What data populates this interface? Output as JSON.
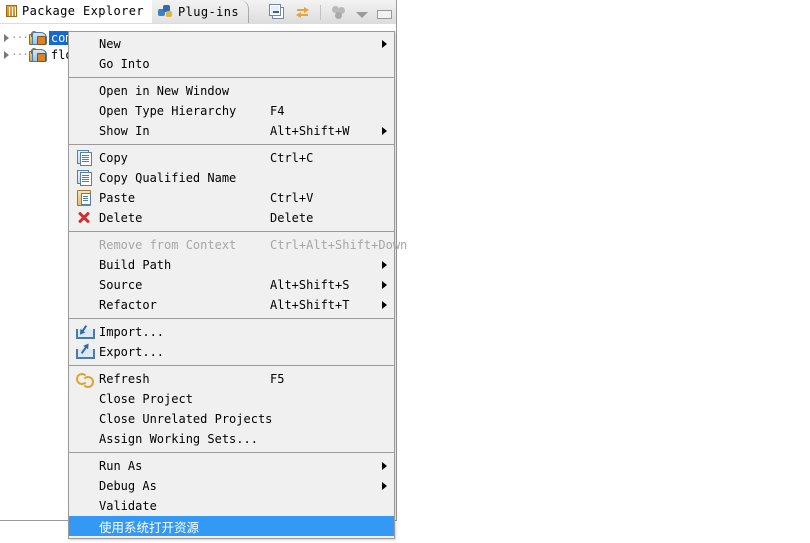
{
  "view": {
    "tabs": [
      {
        "label": "Package Explorer",
        "icon": "package-explorer-icon",
        "active": true,
        "close": "✖"
      },
      {
        "label": "Plug-ins",
        "icon": "plugins-icon",
        "active": false
      }
    ],
    "toolbar": [
      {
        "name": "collapse-all-icon"
      },
      {
        "name": "link-with-editor-icon"
      },
      {
        "name": "view-menu-icon"
      },
      {
        "name": "view-dropdown-icon"
      },
      {
        "name": "minimize-icon"
      }
    ],
    "tree": [
      {
        "label": "com.l",
        "selected": true,
        "icon": "package-fragment-icon"
      },
      {
        "label": "flow",
        "selected": false,
        "icon": "package-fragment-icon"
      }
    ]
  },
  "context_menu": {
    "items": [
      {
        "label": "New",
        "shortcut": "",
        "icon": "",
        "submenu": true,
        "disabled": false,
        "highlighted": false
      },
      {
        "label": "Go Into",
        "shortcut": "",
        "icon": "",
        "submenu": false,
        "disabled": false,
        "highlighted": false
      },
      {
        "separator": true
      },
      {
        "label": "Open in New Window",
        "shortcut": "",
        "icon": "",
        "submenu": false,
        "disabled": false,
        "highlighted": false
      },
      {
        "label": "Open Type Hierarchy",
        "shortcut": "F4",
        "icon": "",
        "submenu": false,
        "disabled": false,
        "highlighted": false
      },
      {
        "label": "Show In",
        "shortcut": "Alt+Shift+W",
        "icon": "",
        "submenu": true,
        "disabled": false,
        "highlighted": false
      },
      {
        "separator": true
      },
      {
        "label": "Copy",
        "shortcut": "Ctrl+C",
        "icon": "copy-icon",
        "submenu": false,
        "disabled": false,
        "highlighted": false
      },
      {
        "label": "Copy Qualified Name",
        "shortcut": "",
        "icon": "copy-icon",
        "submenu": false,
        "disabled": false,
        "highlighted": false
      },
      {
        "label": "Paste",
        "shortcut": "Ctrl+V",
        "icon": "paste-icon",
        "submenu": false,
        "disabled": false,
        "highlighted": false
      },
      {
        "label": "Delete",
        "shortcut": "Delete",
        "icon": "delete-icon",
        "submenu": false,
        "disabled": false,
        "highlighted": false
      },
      {
        "separator": true
      },
      {
        "label": "Remove from Context",
        "shortcut": "Ctrl+Alt+Shift+Down",
        "icon": "",
        "submenu": false,
        "disabled": true,
        "highlighted": false
      },
      {
        "label": "Build Path",
        "shortcut": "",
        "icon": "",
        "submenu": true,
        "disabled": false,
        "highlighted": false
      },
      {
        "label": "Source",
        "shortcut": "Alt+Shift+S",
        "icon": "",
        "submenu": true,
        "disabled": false,
        "highlighted": false
      },
      {
        "label": "Refactor",
        "shortcut": "Alt+Shift+T",
        "icon": "",
        "submenu": true,
        "disabled": false,
        "highlighted": false
      },
      {
        "separator": true
      },
      {
        "label": "Import...",
        "shortcut": "",
        "icon": "import-icon",
        "submenu": false,
        "disabled": false,
        "highlighted": false
      },
      {
        "label": "Export...",
        "shortcut": "",
        "icon": "export-icon",
        "submenu": false,
        "disabled": false,
        "highlighted": false
      },
      {
        "separator": true
      },
      {
        "label": "Refresh",
        "shortcut": "F5",
        "icon": "refresh-icon",
        "submenu": false,
        "disabled": false,
        "highlighted": false
      },
      {
        "label": "Close Project",
        "shortcut": "",
        "icon": "",
        "submenu": false,
        "disabled": false,
        "highlighted": false
      },
      {
        "label": "Close Unrelated Projects",
        "shortcut": "",
        "icon": "",
        "submenu": false,
        "disabled": false,
        "highlighted": false
      },
      {
        "label": "Assign Working Sets...",
        "shortcut": "",
        "icon": "",
        "submenu": false,
        "disabled": false,
        "highlighted": false
      },
      {
        "separator": true
      },
      {
        "label": "Run As",
        "shortcut": "",
        "icon": "",
        "submenu": true,
        "disabled": false,
        "highlighted": false
      },
      {
        "label": "Debug As",
        "shortcut": "",
        "icon": "",
        "submenu": true,
        "disabled": false,
        "highlighted": false
      },
      {
        "label": "Validate",
        "shortcut": "",
        "icon": "",
        "submenu": false,
        "disabled": false,
        "highlighted": false
      },
      {
        "label": "使用系统打开资源",
        "shortcut": "",
        "icon": "",
        "submenu": false,
        "disabled": false,
        "highlighted": true
      }
    ]
  },
  "colors": {
    "menu_bg": "#f0f0f0",
    "menu_border": "#9a9a9a",
    "highlight": "#3399f5",
    "selection": "#1569d0",
    "disabled_text": "#a6a6a6"
  }
}
